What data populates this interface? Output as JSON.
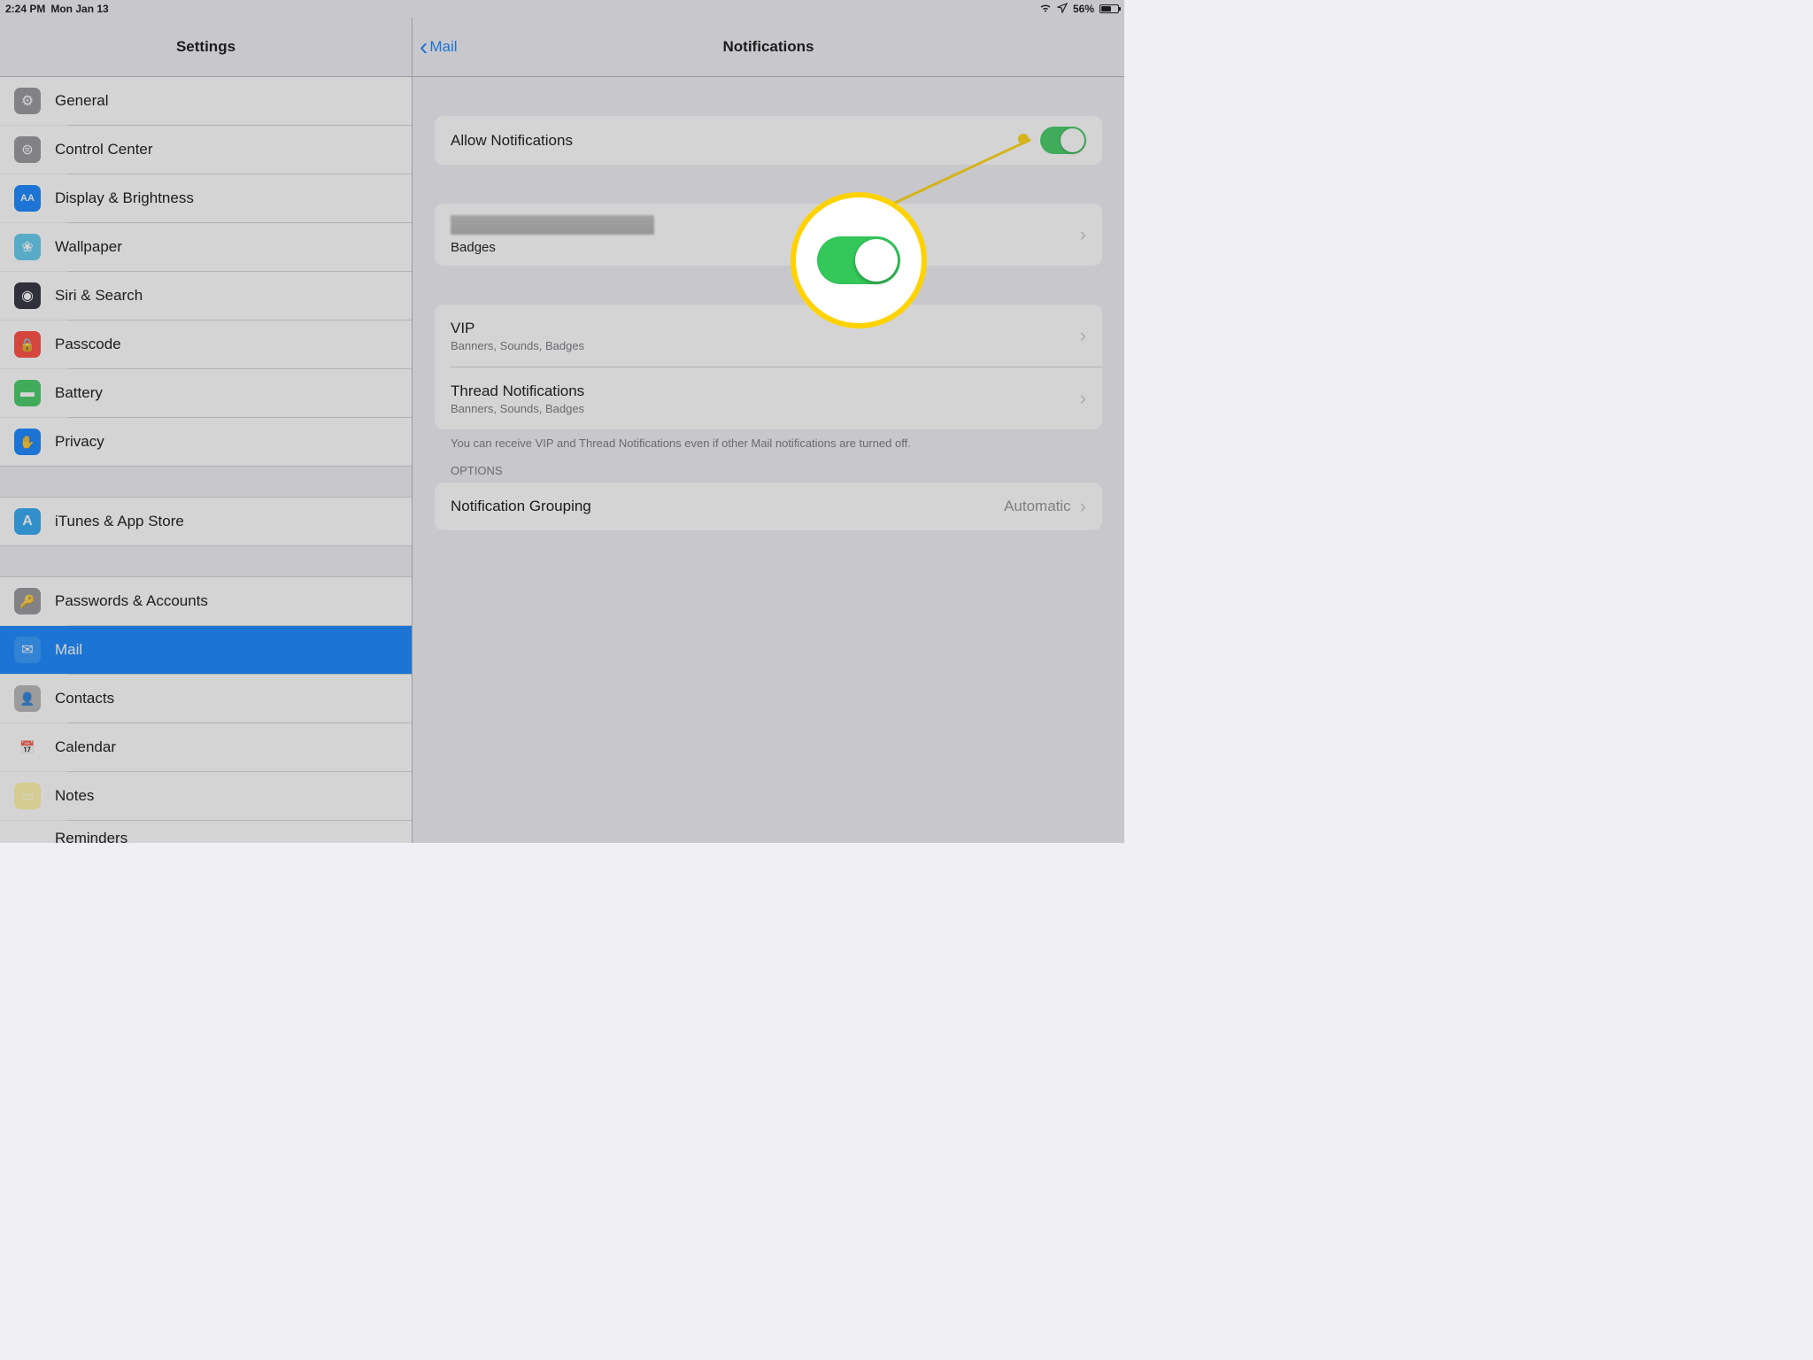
{
  "statusbar": {
    "time": "2:24 PM",
    "date": "Mon Jan 13",
    "battery_pct": "56%"
  },
  "sidebar": {
    "title": "Settings",
    "items": [
      {
        "label": "General",
        "icon_bg": "#8e8e93",
        "glyph": "⚙"
      },
      {
        "label": "Control Center",
        "icon_bg": "#8e8e93",
        "glyph": "⊜"
      },
      {
        "label": "Display & Brightness",
        "icon_bg": "#007aff",
        "glyph": "AA"
      },
      {
        "label": "Wallpaper",
        "icon_bg": "#54c7ec",
        "glyph": "❀"
      },
      {
        "label": "Siri & Search",
        "icon_bg": "#1c1c2e",
        "glyph": "◉"
      },
      {
        "label": "Passcode",
        "icon_bg": "#ff3b30",
        "glyph": "🔒"
      },
      {
        "label": "Battery",
        "icon_bg": "#34c759",
        "glyph": "▬"
      },
      {
        "label": "Privacy",
        "icon_bg": "#007aff",
        "glyph": "✋"
      }
    ],
    "items2": [
      {
        "label": "iTunes & App Store",
        "icon_bg": "#1ea0f1",
        "glyph": "A"
      }
    ],
    "items3": [
      {
        "label": "Passwords & Accounts",
        "icon_bg": "#8e8e93",
        "glyph": "🔑"
      },
      {
        "label": "Mail",
        "icon_bg": "#1f8fff",
        "glyph": "✉",
        "selected": true
      },
      {
        "label": "Contacts",
        "icon_bg": "#b0b0b0",
        "glyph": "👤"
      },
      {
        "label": "Calendar",
        "icon_bg": "#ffffff",
        "glyph": "📅"
      },
      {
        "label": "Notes",
        "icon_bg": "#fff4a3",
        "glyph": "▭"
      },
      {
        "label": "Reminders",
        "icon_bg": "#ffffff",
        "glyph": "☰"
      }
    ]
  },
  "detail": {
    "back_label": "Mail",
    "title": "Notifications",
    "allow_label": "Allow Notifications",
    "badges_label": "Badges",
    "vip_label": "VIP",
    "vip_sub": "Banners, Sounds, Badges",
    "thread_label": "Thread Notifications",
    "thread_sub": "Banners, Sounds, Badges",
    "footer": "You can receive VIP and Thread Notifications even if other Mail notifications are turned off.",
    "options_header": "OPTIONS",
    "grouping_label": "Notification Grouping",
    "grouping_value": "Automatic"
  }
}
